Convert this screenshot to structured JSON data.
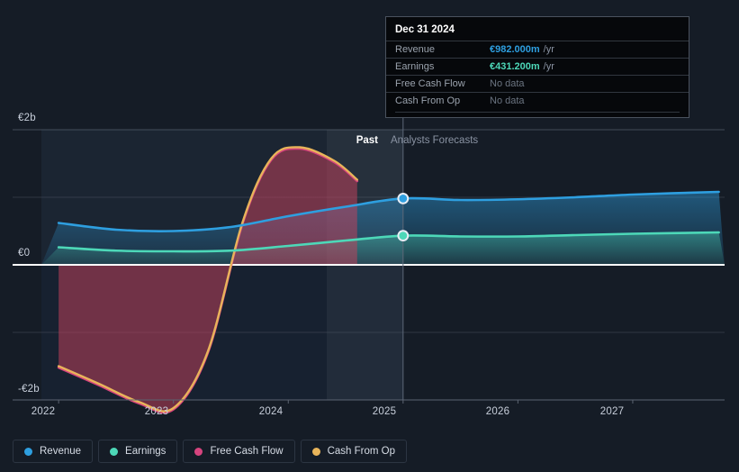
{
  "chart_data": {
    "type": "area",
    "title": "",
    "xlabel": "",
    "ylabel": "",
    "currency": "EUR",
    "grid": true,
    "legend_position": "bottom-left",
    "x": [
      "2022",
      "2023",
      "2024",
      "2025",
      "2026",
      "2027"
    ],
    "xlim": [
      2021.85,
      2027.8
    ],
    "ylim": [
      -2.4,
      2.2
    ],
    "yticks": [
      {
        "value": 2,
        "label": "€2b"
      },
      {
        "value": 0,
        "label": "€0"
      },
      {
        "value": -2,
        "label": "-€2b"
      }
    ],
    "xticks": [
      "2022",
      "2023",
      "2024",
      "2025",
      "2026",
      "2027"
    ],
    "forecast_boundary": "2025",
    "series": [
      {
        "name": "Revenue",
        "color": "#2e9fe0",
        "points": [
          {
            "x": 2022.0,
            "y": 0.62
          },
          {
            "x": 2022.5,
            "y": 0.52
          },
          {
            "x": 2023.0,
            "y": 0.5
          },
          {
            "x": 2023.5,
            "y": 0.56
          },
          {
            "x": 2024.0,
            "y": 0.72
          },
          {
            "x": 2024.5,
            "y": 0.86
          },
          {
            "x": 2025.0,
            "y": 0.982
          },
          {
            "x": 2025.5,
            "y": 0.96
          },
          {
            "x": 2026.0,
            "y": 0.97
          },
          {
            "x": 2026.5,
            "y": 1.0
          },
          {
            "x": 2027.0,
            "y": 1.04
          },
          {
            "x": 2027.75,
            "y": 1.08
          }
        ]
      },
      {
        "name": "Earnings",
        "color": "#4dd8b8",
        "points": [
          {
            "x": 2022.0,
            "y": 0.26
          },
          {
            "x": 2022.5,
            "y": 0.21
          },
          {
            "x": 2023.0,
            "y": 0.2
          },
          {
            "x": 2023.5,
            "y": 0.21
          },
          {
            "x": 2024.0,
            "y": 0.28
          },
          {
            "x": 2024.5,
            "y": 0.36
          },
          {
            "x": 2025.0,
            "y": 0.4312
          },
          {
            "x": 2025.5,
            "y": 0.42
          },
          {
            "x": 2026.0,
            "y": 0.42
          },
          {
            "x": 2026.5,
            "y": 0.44
          },
          {
            "x": 2027.0,
            "y": 0.46
          },
          {
            "x": 2027.75,
            "y": 0.48
          }
        ]
      },
      {
        "name": "Free Cash Flow",
        "color": "#d6447e",
        "points": [
          {
            "x": 2022.0,
            "y": -1.52
          },
          {
            "x": 2022.35,
            "y": -1.78
          },
          {
            "x": 2022.7,
            "y": -2.05
          },
          {
            "x": 2023.0,
            "y": -2.14
          },
          {
            "x": 2023.3,
            "y": -1.3
          },
          {
            "x": 2023.6,
            "y": 0.6
          },
          {
            "x": 2023.85,
            "y": 1.55
          },
          {
            "x": 2024.1,
            "y": 1.72
          },
          {
            "x": 2024.4,
            "y": 1.52
          },
          {
            "x": 2024.6,
            "y": 1.24
          }
        ]
      },
      {
        "name": "Cash From Op",
        "color": "#e8b45a",
        "points": [
          {
            "x": 2022.0,
            "y": -1.5
          },
          {
            "x": 2022.35,
            "y": -1.76
          },
          {
            "x": 2022.7,
            "y": -2.03
          },
          {
            "x": 2023.0,
            "y": -2.12
          },
          {
            "x": 2023.3,
            "y": -1.28
          },
          {
            "x": 2023.6,
            "y": 0.62
          },
          {
            "x": 2023.85,
            "y": 1.57
          },
          {
            "x": 2024.1,
            "y": 1.74
          },
          {
            "x": 2024.4,
            "y": 1.54
          },
          {
            "x": 2024.6,
            "y": 1.26
          }
        ]
      }
    ]
  },
  "phases": {
    "past_label": "Past",
    "forecast_label": "Analysts Forecasts"
  },
  "tooltip": {
    "date": "Dec 31 2024",
    "rows": [
      {
        "label": "Revenue",
        "value": "€982.000m",
        "unit": "/yr",
        "color": "#2e9fe0",
        "nodata": false
      },
      {
        "label": "Earnings",
        "value": "€431.200m",
        "unit": "/yr",
        "color": "#4dd8b8",
        "nodata": false
      },
      {
        "label": "Free Cash Flow",
        "value": "No data",
        "unit": "",
        "color": "#6b7481",
        "nodata": true
      },
      {
        "label": "Cash From Op",
        "value": "No data",
        "unit": "",
        "color": "#6b7481",
        "nodata": true
      }
    ]
  },
  "legend": {
    "items": [
      {
        "label": "Revenue",
        "color": "#2e9fe0"
      },
      {
        "label": "Earnings",
        "color": "#4dd8b8"
      },
      {
        "label": "Free Cash Flow",
        "color": "#d6447e"
      },
      {
        "label": "Cash From Op",
        "color": "#e8b45a"
      }
    ]
  }
}
